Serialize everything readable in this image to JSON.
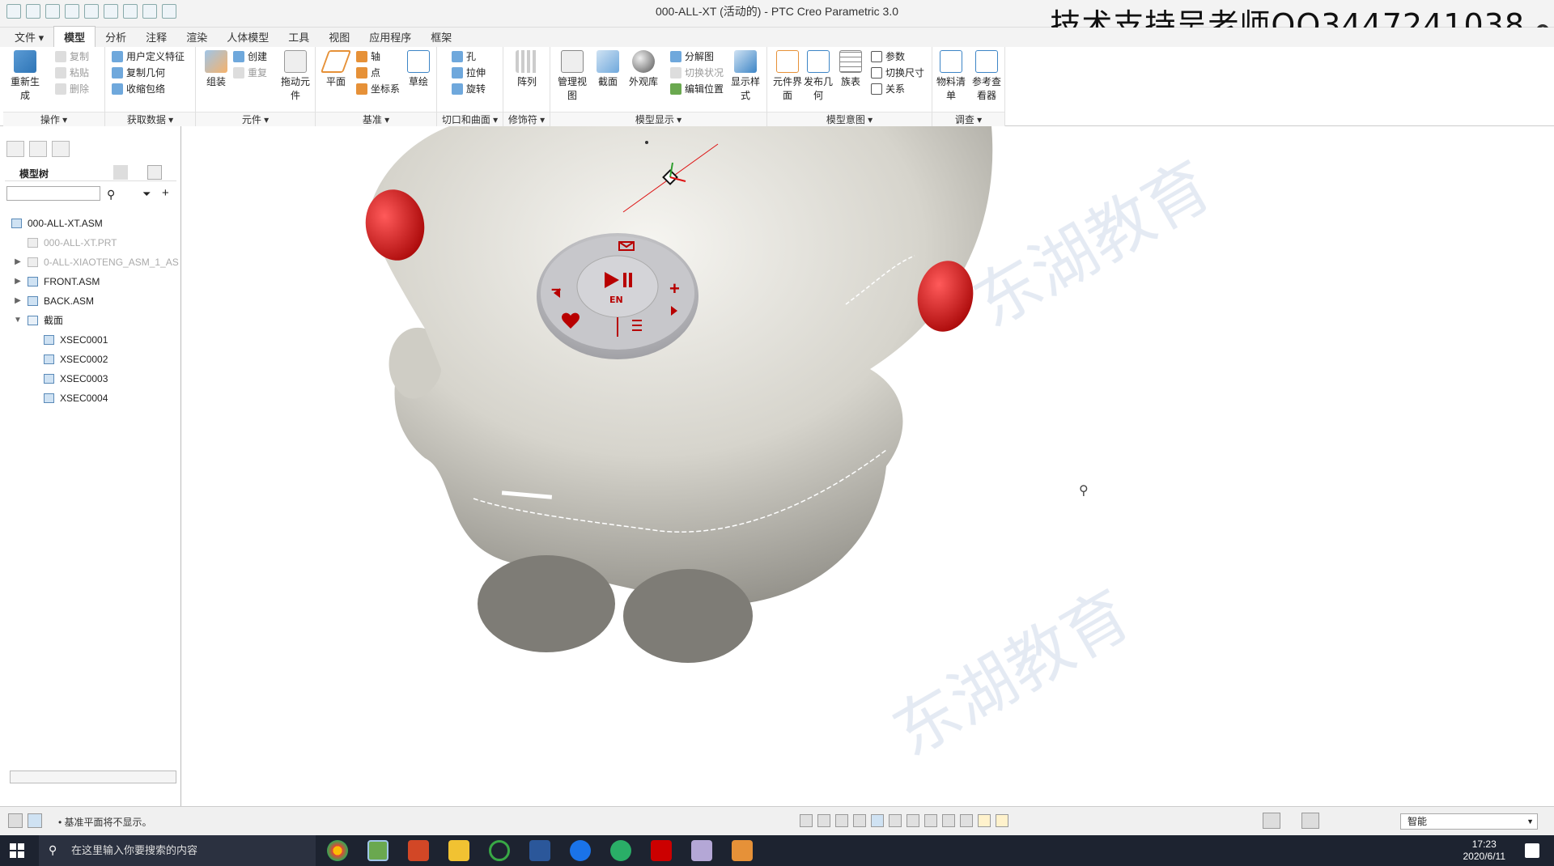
{
  "window": {
    "title": "000-ALL-XT (活动的) - PTC Creo Parametric 3.0",
    "overlay_text": "技术支持吴老师QQ3447241038",
    "help": "?"
  },
  "tabs": [
    {
      "label": "文件 ▾"
    },
    {
      "label": "模型"
    },
    {
      "label": "分析"
    },
    {
      "label": "注释"
    },
    {
      "label": "渲染"
    },
    {
      "label": "人体模型"
    },
    {
      "label": "工具"
    },
    {
      "label": "视图"
    },
    {
      "label": "应用程序"
    },
    {
      "label": "框架"
    }
  ],
  "ribbon": {
    "operations": {
      "regen": "重新生成",
      "copy": "复制",
      "paste": "粘贴",
      "delete": "删除",
      "group": "操作 ▾"
    },
    "get_data": {
      "udf": "用户定义特征",
      "copy_geom": "复制几何",
      "shrinkwrap": "收缩包络",
      "group": "获取数据 ▾"
    },
    "component": {
      "assemble": "组装",
      "create": "创建",
      "repeat": "重复",
      "drag": "拖动元件",
      "group": "元件 ▾"
    },
    "datum": {
      "plane": "平面",
      "axis": "轴",
      "point": "点",
      "csys": "坐标系",
      "sketch": "草绘",
      "group": "基准 ▾"
    },
    "cut_surface": {
      "hole": "孔",
      "extrude": "拉伸",
      "revolve": "旋转",
      "group": "切口和曲面 ▾"
    },
    "modifiers": {
      "pattern": "阵列",
      "group": "修饰符 ▾"
    },
    "model_display": {
      "manage_views": "管理视图",
      "section": "截面",
      "appearance": "外观库",
      "exploded": "分解图",
      "toggle_state": "切换状况",
      "edit_position": "编辑位置",
      "display_style": "显示样式",
      "group": "模型显示 ▾"
    },
    "model_intent": {
      "component_interface": "元件界面",
      "publish_geom": "发布几何",
      "family_table": "族表",
      "params": "参数",
      "switch_dims": "切换尺寸",
      "relations": "关系",
      "group": "模型意图 ▾"
    },
    "investigate": {
      "bom": "物料清单",
      "ref_viewer": "参考查看器",
      "group": "调查 ▾"
    }
  },
  "model_tree": {
    "title": "模型树",
    "search_placeholder": "",
    "items": [
      {
        "label": "000-ALL-XT.ASM",
        "level": 0,
        "expander": "",
        "dim": false
      },
      {
        "label": "000-ALL-XT.PRT",
        "level": 1,
        "expander": "",
        "dim": true
      },
      {
        "label": "0-ALL-XIAOTENG_ASM_1_AS",
        "level": 0,
        "expander": "▶",
        "dim": true
      },
      {
        "label": "FRONT.ASM",
        "level": 0,
        "expander": "▶",
        "dim": false
      },
      {
        "label": "BACK.ASM",
        "level": 0,
        "expander": "▶",
        "dim": false
      },
      {
        "label": "截面",
        "level": 0,
        "expander": "▼",
        "dim": false
      },
      {
        "label": "XSEC0001",
        "level": 2,
        "expander": "",
        "dim": false
      },
      {
        "label": "XSEC0002",
        "level": 2,
        "expander": "",
        "dim": false
      },
      {
        "label": "XSEC0003",
        "level": 2,
        "expander": "",
        "dim": false
      },
      {
        "label": "XSEC0004",
        "level": 2,
        "expander": "",
        "dim": false
      }
    ]
  },
  "viewport": {
    "watermark": "东湖教育",
    "control_labels": {
      "en": "EN"
    }
  },
  "status": {
    "message": "• 基准平面将不显示。",
    "filter": "智能"
  },
  "taskbar": {
    "search": "在这里输入你要搜索的内容",
    "time": "17:23",
    "date": "2020/6/11"
  },
  "colors": {
    "model_body": "#d8d6ce",
    "accent_red": "#cc0000",
    "ribbon_bg": "#ffffff",
    "taskbar": "#1d2330"
  }
}
